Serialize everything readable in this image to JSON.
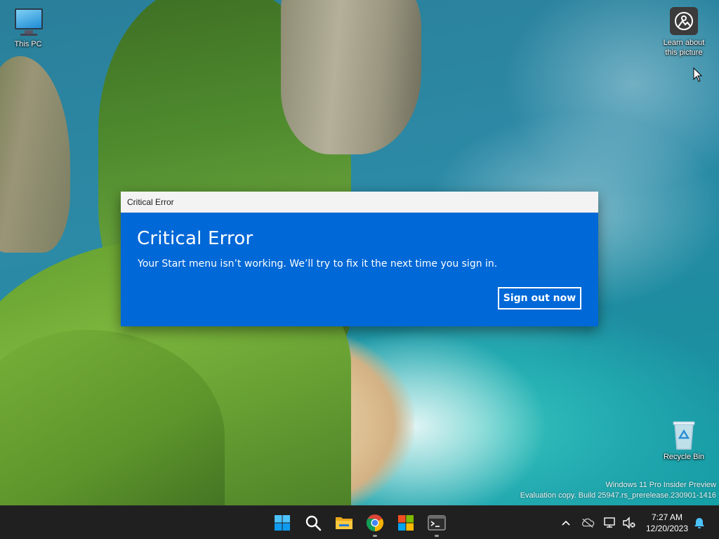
{
  "desktop": {
    "icons": [
      {
        "id": "this-pc",
        "label": "This PC"
      },
      {
        "id": "learn",
        "label_line1": "Learn about",
        "label_line2": "this picture"
      },
      {
        "id": "recycle",
        "label": "Recycle Bin"
      }
    ],
    "watermark": {
      "line1": "Windows 11 Pro Insider Preview",
      "line2": "Evaluation copy. Build 25947.rs_prerelease.230901-1416"
    }
  },
  "dialog": {
    "window_title": "Critical Error",
    "heading": "Critical Error",
    "message": "Your Start menu isn’t working. We’ll try to fix it the next time you sign in.",
    "button_label": "Sign out now",
    "accent_color": "#0068d7"
  },
  "taskbar": {
    "apps": [
      "start-icon",
      "search-icon",
      "file-explorer-icon",
      "chrome-icon",
      "microsoft-store-icon",
      "terminal-icon"
    ],
    "tray": [
      "show-hidden-icons-chevron",
      "onedrive-icon",
      "network-icon",
      "volume-icon",
      "notification-bell-icon"
    ],
    "clock": {
      "time": "7:27 AM",
      "date": "12/20/2023"
    }
  }
}
